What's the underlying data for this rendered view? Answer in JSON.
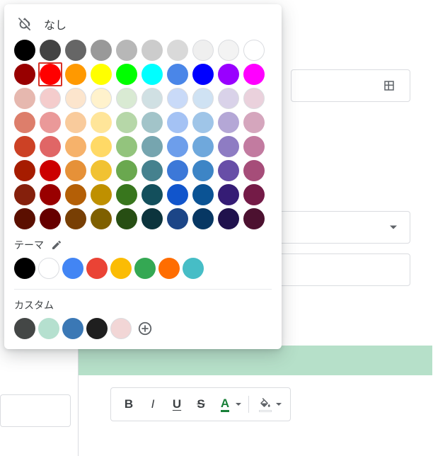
{
  "popup": {
    "reset_label": "なし",
    "section_theme_label": "テーマ",
    "section_custom_label": "カスタム",
    "selected_index": [
      1,
      1
    ],
    "grid": [
      [
        {
          "hex": "#000000"
        },
        {
          "hex": "#434343"
        },
        {
          "hex": "#666666"
        },
        {
          "hex": "#999999"
        },
        {
          "hex": "#b7b7b7"
        },
        {
          "hex": "#cccccc"
        },
        {
          "hex": "#d9d9d9"
        },
        {
          "hex": "#efefef",
          "light": true
        },
        {
          "hex": "#f3f3f3",
          "light": true
        },
        {
          "hex": "#ffffff",
          "light": true
        }
      ],
      [
        {
          "hex": "#980000"
        },
        {
          "hex": "#ff0000",
          "selected": true
        },
        {
          "hex": "#ff9900"
        },
        {
          "hex": "#ffff00"
        },
        {
          "hex": "#00ff00"
        },
        {
          "hex": "#00ffff"
        },
        {
          "hex": "#4a86e8"
        },
        {
          "hex": "#0000ff"
        },
        {
          "hex": "#9900ff"
        },
        {
          "hex": "#ff00ff"
        }
      ],
      [
        {
          "hex": "#e6b8af"
        },
        {
          "hex": "#f4cccc",
          "light": true
        },
        {
          "hex": "#fce5cd",
          "light": true
        },
        {
          "hex": "#fff2cc",
          "light": true
        },
        {
          "hex": "#d9ead3",
          "light": true
        },
        {
          "hex": "#d0e0e3",
          "light": true
        },
        {
          "hex": "#c9daf8",
          "light": true
        },
        {
          "hex": "#cfe2f3",
          "light": true
        },
        {
          "hex": "#d9d2e9",
          "light": true
        },
        {
          "hex": "#ead1dc",
          "light": true
        }
      ],
      [
        {
          "hex": "#dd7e6b"
        },
        {
          "hex": "#ea9999"
        },
        {
          "hex": "#f9cb9c"
        },
        {
          "hex": "#ffe599"
        },
        {
          "hex": "#b6d7a8"
        },
        {
          "hex": "#a2c4c9"
        },
        {
          "hex": "#a4c2f4"
        },
        {
          "hex": "#9fc5e8"
        },
        {
          "hex": "#b4a7d6"
        },
        {
          "hex": "#d5a6bd"
        }
      ],
      [
        {
          "hex": "#cc4125"
        },
        {
          "hex": "#e06666"
        },
        {
          "hex": "#f6b26b"
        },
        {
          "hex": "#ffd966"
        },
        {
          "hex": "#93c47d"
        },
        {
          "hex": "#76a5af"
        },
        {
          "hex": "#6d9eeb"
        },
        {
          "hex": "#6fa8dc"
        },
        {
          "hex": "#8e7cc3"
        },
        {
          "hex": "#c27ba0"
        }
      ],
      [
        {
          "hex": "#a61c00"
        },
        {
          "hex": "#cc0000"
        },
        {
          "hex": "#e69138"
        },
        {
          "hex": "#f1c232"
        },
        {
          "hex": "#6aa84f"
        },
        {
          "hex": "#45818e"
        },
        {
          "hex": "#3c78d8"
        },
        {
          "hex": "#3d85c6"
        },
        {
          "hex": "#674ea7"
        },
        {
          "hex": "#a64d79"
        }
      ],
      [
        {
          "hex": "#85200c"
        },
        {
          "hex": "#990000"
        },
        {
          "hex": "#b45f06"
        },
        {
          "hex": "#bf9000"
        },
        {
          "hex": "#38761d"
        },
        {
          "hex": "#134f5c"
        },
        {
          "hex": "#1155cc"
        },
        {
          "hex": "#0b5394"
        },
        {
          "hex": "#351c75"
        },
        {
          "hex": "#741b47"
        }
      ],
      [
        {
          "hex": "#5b0f00"
        },
        {
          "hex": "#660000"
        },
        {
          "hex": "#783f04"
        },
        {
          "hex": "#7f6000"
        },
        {
          "hex": "#274e13"
        },
        {
          "hex": "#0c343d"
        },
        {
          "hex": "#1c4587"
        },
        {
          "hex": "#073763"
        },
        {
          "hex": "#20124d"
        },
        {
          "hex": "#4c1130"
        }
      ]
    ],
    "theme_colors": [
      {
        "hex": "#000000"
      },
      {
        "hex": "#ffffff",
        "light": true
      },
      {
        "hex": "#4285f4"
      },
      {
        "hex": "#ea4335"
      },
      {
        "hex": "#fbbc04"
      },
      {
        "hex": "#34a853"
      },
      {
        "hex": "#ff6d01"
      },
      {
        "hex": "#46bdc6"
      }
    ],
    "custom_colors": [
      {
        "hex": "#444746"
      },
      {
        "hex": "#b5e0cf"
      },
      {
        "hex": "#3b78b5"
      },
      {
        "hex": "#1f1f1f"
      },
      {
        "hex": "#f2d6d6",
        "light": true
      }
    ]
  },
  "toolbar": {
    "bold": "B",
    "italic": "I",
    "underline": "U",
    "strike": "S",
    "textcolor": "A"
  }
}
